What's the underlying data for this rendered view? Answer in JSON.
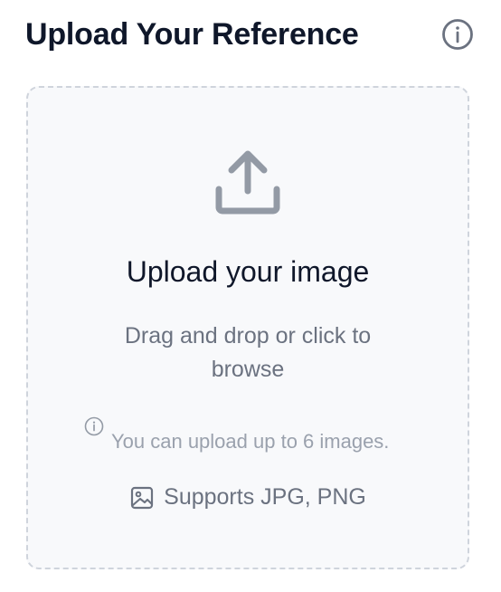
{
  "header": {
    "title": "Upload Your Reference",
    "info_icon": "info-circle-icon"
  },
  "dropzone": {
    "icon": "upload-icon",
    "title": "Upload your image",
    "subtitle": "Drag and drop or click to browse",
    "limit_icon": "info-circle-icon",
    "limit_text": "You can upload up to 6 images.",
    "supports_icon": "image-icon",
    "supports_text": "Supports JPG, PNG"
  },
  "colors": {
    "title": "#0f172a",
    "muted": "#6b7280",
    "icon": "#939aa5",
    "border": "#cfd4dc",
    "dropzone_bg": "#f8f9fb"
  }
}
